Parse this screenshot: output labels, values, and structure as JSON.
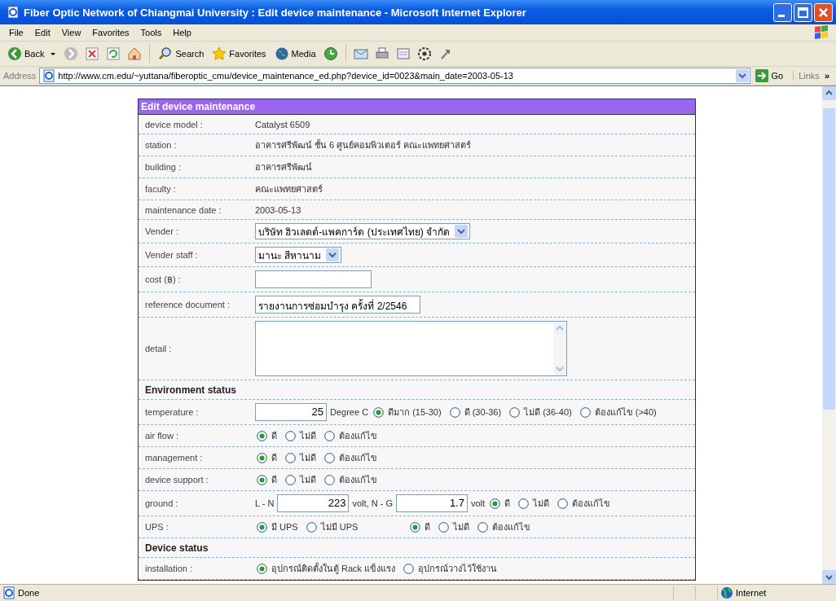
{
  "window": {
    "title": "Fiber Optic Network of Chiangmai University : Edit device maintenance - Microsoft Internet Explorer"
  },
  "menu": [
    "File",
    "Edit",
    "View",
    "Favorites",
    "Tools",
    "Help"
  ],
  "toolbar": [
    {
      "kind": "back",
      "label": "Back"
    },
    {
      "kind": "search",
      "label": "Search"
    },
    {
      "kind": "favorites",
      "label": "Favorites"
    },
    {
      "kind": "media",
      "label": "Media"
    }
  ],
  "address": {
    "label": "Address",
    "url": "http://www.cm.edu/~yuttana/fiberoptic_cmu/device_maintenance_ed.php?device_id=0023&main_date=2003-05-13",
    "go": "Go",
    "links": "Links",
    "more": "»"
  },
  "form": {
    "title": "Edit device maintenance",
    "rows": [
      {
        "kind": "field",
        "label": "device model :",
        "parts": [
          {
            "kind": "text",
            "value": "Catalyst 6509"
          }
        ]
      },
      {
        "kind": "field",
        "label": "station :",
        "parts": [
          {
            "kind": "text",
            "value": "อาคารศรีพัฒน์ ชั้น 6 ศูนย์คอมพิวเตอร์ คณะแพทยศาสตร์"
          }
        ]
      },
      {
        "kind": "field",
        "label": "building :",
        "parts": [
          {
            "kind": "text",
            "value": "อาคารศรีพัฒน์"
          }
        ]
      },
      {
        "kind": "field",
        "label": "faculty :",
        "parts": [
          {
            "kind": "text",
            "value": "คณะแพทยศาสตร์"
          }
        ]
      },
      {
        "kind": "field",
        "label": "maintenance date :",
        "parts": [
          {
            "kind": "text",
            "value": "2003-05-13"
          }
        ]
      },
      {
        "kind": "field",
        "label": "Vender :",
        "parts": [
          {
            "kind": "select",
            "value": "บริษัท ฮิวเลตต์-แพคการ์ด (ประเทศไทย) จำกัด"
          }
        ]
      },
      {
        "kind": "field",
        "label": "Vender staff :",
        "parts": [
          {
            "kind": "select",
            "value": "มานะ สีหานาม"
          }
        ]
      },
      {
        "kind": "field",
        "label": "cost (฿) :",
        "parts": [
          {
            "kind": "input"
          }
        ]
      },
      {
        "kind": "field",
        "label": "reference document :",
        "parts": [
          {
            "kind": "input",
            "value": "รายงานการซ่อมบำรุง ครั้งที่ 2/2546"
          }
        ]
      },
      {
        "kind": "field",
        "label": "detail :",
        "parts": [
          {
            "kind": "textarea"
          }
        ]
      },
      {
        "kind": "section",
        "label": "Environment status"
      },
      {
        "kind": "field",
        "label": "temperature :",
        "parts": [
          {
            "kind": "number",
            "value": "25"
          },
          {
            "kind": "text",
            "value": "Degree C"
          },
          {
            "kind": "radios",
            "options": [
              {
                "label": "ดีมาก (15-30)",
                "selected": true
              },
              {
                "label": "ดี (30-36)",
                "selected": false
              },
              {
                "label": "ไม่ดี (36-40)",
                "selected": false
              },
              {
                "label": "ต้องแก้ไข (>40)",
                "selected": false
              }
            ]
          }
        ]
      },
      {
        "kind": "field",
        "label": "air flow :",
        "parts": [
          {
            "kind": "radios",
            "options": [
              {
                "label": "ดี",
                "selected": true
              },
              {
                "label": "ไม่ดี",
                "selected": false
              },
              {
                "label": "ต้องแก้ไข",
                "selected": false
              }
            ]
          }
        ]
      },
      {
        "kind": "field",
        "label": "management :",
        "parts": [
          {
            "kind": "radios",
            "options": [
              {
                "label": "ดี",
                "selected": true
              },
              {
                "label": "ไม่ดี",
                "selected": false
              },
              {
                "label": "ต้องแก้ไข",
                "selected": false
              }
            ]
          }
        ]
      },
      {
        "kind": "field",
        "label": "device support :",
        "parts": [
          {
            "kind": "radios",
            "options": [
              {
                "label": "ดี",
                "selected": true
              },
              {
                "label": "ไม่ดี",
                "selected": false
              },
              {
                "label": "ต้องแก้ไข",
                "selected": false
              }
            ]
          }
        ]
      },
      {
        "kind": "field",
        "label": "ground :",
        "parts": [
          {
            "kind": "text",
            "value": "L - N"
          },
          {
            "kind": "number",
            "value": "223"
          },
          {
            "kind": "text",
            "value": "volt,  N - G"
          },
          {
            "kind": "number",
            "value": "1.7"
          },
          {
            "kind": "text",
            "value": "volt"
          },
          {
            "kind": "radios",
            "options": [
              {
                "label": "ดี",
                "selected": true
              },
              {
                "label": "ไม่ดี",
                "selected": false
              },
              {
                "label": "ต้องแก้ไข",
                "selected": false
              }
            ]
          }
        ]
      },
      {
        "kind": "field",
        "label": "UPS :",
        "parts": [
          {
            "kind": "radios",
            "options": [
              {
                "label": "มี UPS",
                "selected": true
              },
              {
                "label": "ไม่มี UPS",
                "selected": false
              }
            ]
          },
          {
            "kind": "radios",
            "options": [
              {
                "label": "ดี",
                "selected": true
              },
              {
                "label": "ไม่ดี",
                "selected": false
              },
              {
                "label": "ต้องแก้ไข",
                "selected": false
              }
            ]
          }
        ]
      },
      {
        "kind": "section",
        "label": "Device status"
      },
      {
        "kind": "field",
        "label": "installation :",
        "parts": [
          {
            "kind": "radios",
            "options": [
              {
                "label": "อุปกรณ์ติดตั้งในตู้ Rack แข็งแรง",
                "selected": true
              },
              {
                "label": "อุปกรณ์วางไว้ใช้งาน",
                "selected": false
              }
            ]
          }
        ]
      }
    ]
  },
  "status_bar": {
    "text": "Done",
    "zone": "Internet"
  }
}
